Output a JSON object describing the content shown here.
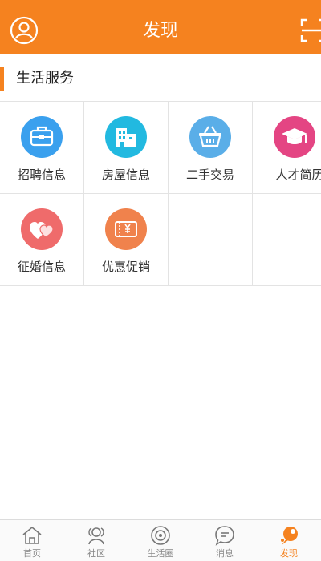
{
  "header": {
    "title": "发现",
    "avatar_icon": "user-circle-icon",
    "scan_icon": "scan-icon"
  },
  "section": {
    "title": "生活服务"
  },
  "services": [
    {
      "label": "招聘信息",
      "icon": "briefcase-icon",
      "color": "#3aa0ee"
    },
    {
      "label": "房屋信息",
      "icon": "building-icon",
      "color": "#22b9e0"
    },
    {
      "label": "二手交易",
      "icon": "basket-icon",
      "color": "#5aaee8"
    },
    {
      "label": "人才简历",
      "icon": "graduation-cap-icon",
      "color": "#e44583"
    },
    {
      "label": "征婚信息",
      "icon": "hearts-icon",
      "color": "#ef6b6b"
    },
    {
      "label": "优惠促销",
      "icon": "coupon-icon",
      "color": "#f0824c"
    }
  ],
  "tabs": [
    {
      "label": "首页",
      "icon": "home-icon"
    },
    {
      "label": "社区",
      "icon": "community-icon"
    },
    {
      "label": "生活圈",
      "icon": "life-circle-icon"
    },
    {
      "label": "消息",
      "icon": "message-icon"
    },
    {
      "label": "发现",
      "icon": "discover-icon",
      "active": true
    }
  ],
  "colors": {
    "accent": "#f5821f",
    "tab_inactive": "#888888"
  }
}
